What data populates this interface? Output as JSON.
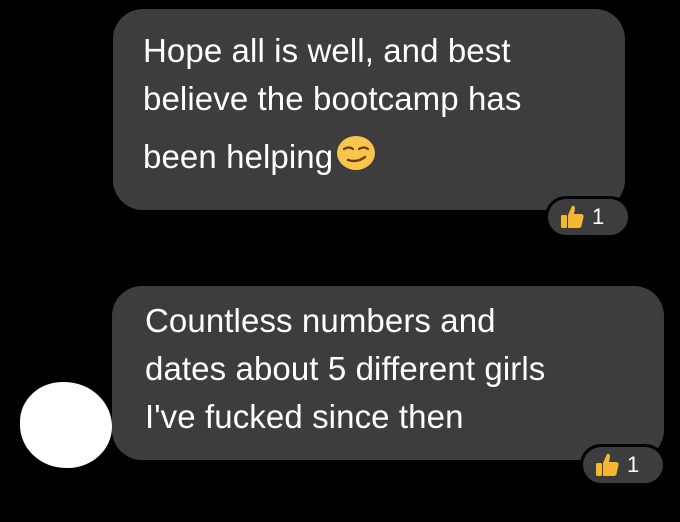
{
  "messages": [
    {
      "lines": [
        "Hope all is well, and best",
        "believe the bootcamp has",
        "been helping"
      ],
      "emoji": "smirk-face-emoji",
      "reaction": {
        "icon": "thumbs-up-icon",
        "count": "1"
      }
    },
    {
      "lines": [
        "Countless numbers and",
        "dates about 5 different girls",
        "I've fucked since then"
      ],
      "reaction": {
        "icon": "thumbs-up-icon",
        "count": "1"
      }
    }
  ],
  "colors": {
    "background": "#000000",
    "bubble": "#3d3d3f",
    "text": "#ffffff",
    "reaction_icon": "#f5b731"
  }
}
